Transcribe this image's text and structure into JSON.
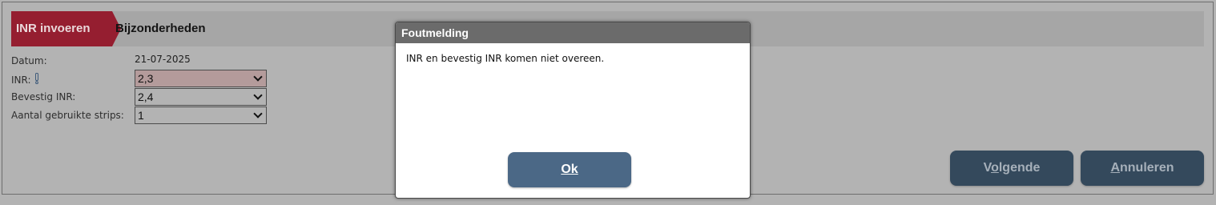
{
  "tabs": {
    "active": "INR invoeren",
    "next": "Bijzonderheden"
  },
  "form": {
    "date_label": "Datum:",
    "date_value": "21-07-2025",
    "inr_label": "INR:",
    "inr_value": "2,3",
    "confirm_label": "Bevestig INR:",
    "confirm_value": "2,4",
    "strips_label": "Aantal gebruikte strips:",
    "strips_value": "1"
  },
  "buttons": {
    "next_pre": "V",
    "next_acc": "o",
    "next_post": "lgende",
    "cancel_acc": "A",
    "cancel_post": "nnuleren"
  },
  "dialog": {
    "title": "Foutmelding",
    "message": "INR en bevestig INR komen niet overeen.",
    "ok_label": "Ok"
  },
  "icons": {
    "inr_warning": "exclamation-icon"
  },
  "colors": {
    "active_tab": "#951e30",
    "error_field": "#b49b9b",
    "primary_button": "#34495c",
    "ok_button": "#4b6886",
    "dialog_title_bar": "#6b6b6b"
  }
}
